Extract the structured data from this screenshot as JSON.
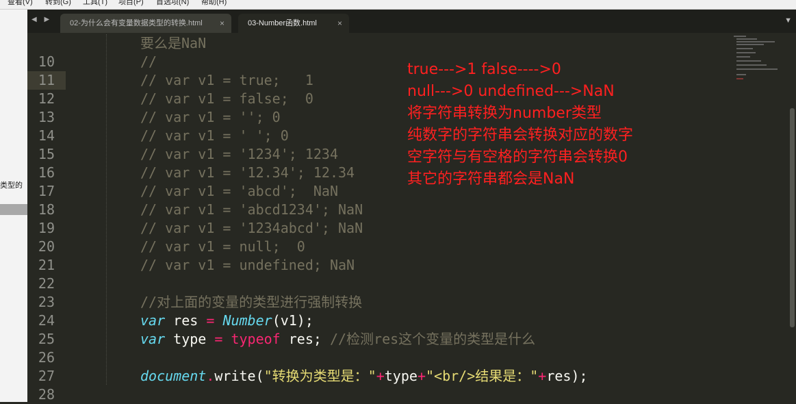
{
  "menu": [
    "查看(V)",
    "转到(G)",
    "工具(T)",
    "项目(P)",
    "首选项(N)",
    "帮助(H)"
  ],
  "left_panel": {
    "fragment": "类型的"
  },
  "tabs": [
    {
      "label": "02-为什么会有变量数据类型的转换.html",
      "close": "×",
      "active": false
    },
    {
      "label": "03-Number函数.html",
      "close": "×",
      "active": true
    }
  ],
  "nav_arrows": "◀ ▶",
  "tab_menu": "▼",
  "current_line": 11,
  "code_lines": [
    {
      "num": "",
      "tokens": [
        {
          "t": "要么是NaN",
          "c": "cm"
        }
      ]
    },
    {
      "num": "10",
      "tokens": [
        {
          "t": "//",
          "c": "cm"
        }
      ]
    },
    {
      "num": "11",
      "tokens": [
        {
          "t": "// var v1 = true;   1",
          "c": "cm"
        }
      ]
    },
    {
      "num": "12",
      "tokens": [
        {
          "t": "// var v1 = false;  0",
          "c": "cm"
        }
      ]
    },
    {
      "num": "13",
      "tokens": [
        {
          "t": "// var v1 = ''; 0",
          "c": "cm"
        }
      ]
    },
    {
      "num": "14",
      "tokens": [
        {
          "t": "// var v1 = ' '; 0",
          "c": "cm"
        }
      ]
    },
    {
      "num": "15",
      "tokens": [
        {
          "t": "// var v1 = '1234'; 1234",
          "c": "cm"
        }
      ]
    },
    {
      "num": "16",
      "tokens": [
        {
          "t": "// var v1 = '12.34'; 12.34",
          "c": "cm"
        }
      ]
    },
    {
      "num": "17",
      "tokens": [
        {
          "t": "// var v1 = 'abcd';  NaN",
          "c": "cm"
        }
      ]
    },
    {
      "num": "18",
      "tokens": [
        {
          "t": "// var v1 = 'abcd1234'; NaN",
          "c": "cm"
        }
      ]
    },
    {
      "num": "19",
      "tokens": [
        {
          "t": "// var v1 = '1234abcd'; NaN",
          "c": "cm"
        }
      ]
    },
    {
      "num": "20",
      "tokens": [
        {
          "t": "// var v1 = null;  0",
          "c": "cm"
        }
      ]
    },
    {
      "num": "21",
      "tokens": [
        {
          "t": "// var v1 = undefined; NaN",
          "c": "cm"
        }
      ]
    },
    {
      "num": "22",
      "tokens": []
    },
    {
      "num": "23",
      "tokens": [
        {
          "t": "//对上面的变量的类型进行强制转换",
          "c": "cm"
        }
      ]
    },
    {
      "num": "24",
      "tokens": [
        {
          "t": "var",
          "c": "kw"
        },
        {
          "t": " res ",
          "c": "pl"
        },
        {
          "t": "=",
          "c": "op"
        },
        {
          "t": " ",
          "c": "pl"
        },
        {
          "t": "Number",
          "c": "fn"
        },
        {
          "t": "(v1);",
          "c": "pl"
        }
      ]
    },
    {
      "num": "25",
      "tokens": [
        {
          "t": "var",
          "c": "kw"
        },
        {
          "t": " type ",
          "c": "pl"
        },
        {
          "t": "=",
          "c": "op"
        },
        {
          "t": " ",
          "c": "pl"
        },
        {
          "t": "typeof",
          "c": "op"
        },
        {
          "t": " res; ",
          "c": "pl"
        },
        {
          "t": "//检测res这个变量的类型是什么",
          "c": "cm"
        }
      ]
    },
    {
      "num": "26",
      "tokens": []
    },
    {
      "num": "27",
      "tokens": [
        {
          "t": "document",
          "c": "fn"
        },
        {
          "t": ".",
          "c": "op"
        },
        {
          "t": "write(",
          "c": "pl"
        },
        {
          "t": "\"转换为类型是：\"",
          "c": "str"
        },
        {
          "t": "+",
          "c": "op"
        },
        {
          "t": "type",
          "c": "pl"
        },
        {
          "t": "+",
          "c": "op"
        },
        {
          "t": "\"<br/>结果是：\"",
          "c": "str"
        },
        {
          "t": "+",
          "c": "op"
        },
        {
          "t": "res);",
          "c": "pl"
        }
      ]
    },
    {
      "num": "28",
      "tokens": []
    }
  ],
  "notes": [
    "true--->1  false---->0",
    "null--->0  undefined--->NaN",
    "将字符串转换为number类型",
    "纯数字的字符串会转换对应的数字",
    "空字符与有空格的字符串会转换0",
    "其它的字符串都会是NaN"
  ],
  "colors": {
    "background": "#272822",
    "comment": "#75715e",
    "keyword": "#66d9ef",
    "operator": "#f92672",
    "string": "#e6db74",
    "note": "#ff2020"
  }
}
